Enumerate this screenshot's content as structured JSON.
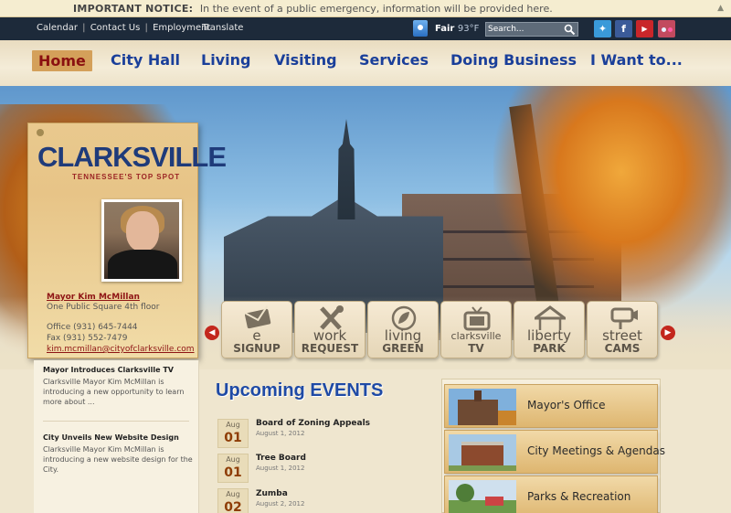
{
  "notice": {
    "label": "IMPORTANT NOTICE:",
    "text": "In the event of a public emergency, information will be provided here."
  },
  "topbar": {
    "links": [
      "Calendar",
      "Contact Us",
      "Employment"
    ],
    "translate": "Translate",
    "weather": {
      "condition": "Fair",
      "temp": "93°F"
    },
    "search_placeholder": "Search..."
  },
  "social": {
    "twitter": "t",
    "facebook": "f",
    "youtube": "You Tube"
  },
  "nav": [
    "Home",
    "City Hall",
    "Living",
    "Visiting",
    "Services",
    "Doing Business",
    "I Want to..."
  ],
  "mayor": {
    "logo": "CLARKSVILLE",
    "tagline": "TENNESSEE'S TOP SPOT",
    "name": "Mayor Kim McMillan",
    "address": "One Public Square 4th floor",
    "office": "Office (931) 645-7444",
    "fax": "Fax (931) 552-7479",
    "email": "kim.mcmillan@cityofclarksville.com"
  },
  "quick_links": [
    {
      "line1": "e",
      "line2": "SIGNUP"
    },
    {
      "line1": "work",
      "line2": "REQUEST"
    },
    {
      "line1": "living",
      "line2": "GREEN"
    },
    {
      "line1": "clarksville",
      "line2": "TV"
    },
    {
      "line1": "liberty",
      "line2": "PARK"
    },
    {
      "line1": "street",
      "line2": "CAMS"
    }
  ],
  "news": [
    {
      "title": "Mayor Introduces Clarksville TV",
      "body": "Clarksville Mayor Kim McMillan is introducing a new opportunity to learn more about ..."
    },
    {
      "title": "City Unveils New Website Design",
      "body": "Clarksville Mayor Kim McMillan is introducing a new website design for the City."
    }
  ],
  "events": {
    "heading": "Upcoming EVENTS",
    "items": [
      {
        "month": "Aug",
        "day": "01",
        "title": "Board of Zoning Appeals",
        "date": "August 1, 2012"
      },
      {
        "month": "Aug",
        "day": "01",
        "title": "Tree Board",
        "date": "August 1, 2012"
      },
      {
        "month": "Aug",
        "day": "02",
        "title": "Zumba",
        "date": "August 2, 2012"
      }
    ]
  },
  "departments": [
    "Mayor's Office",
    "City Meetings & Agendas",
    "Parks & Recreation"
  ],
  "colors": {
    "nav_text": "#1a3f9a",
    "accent_red": "#8e1414",
    "topbar": "#1d2a3a"
  }
}
